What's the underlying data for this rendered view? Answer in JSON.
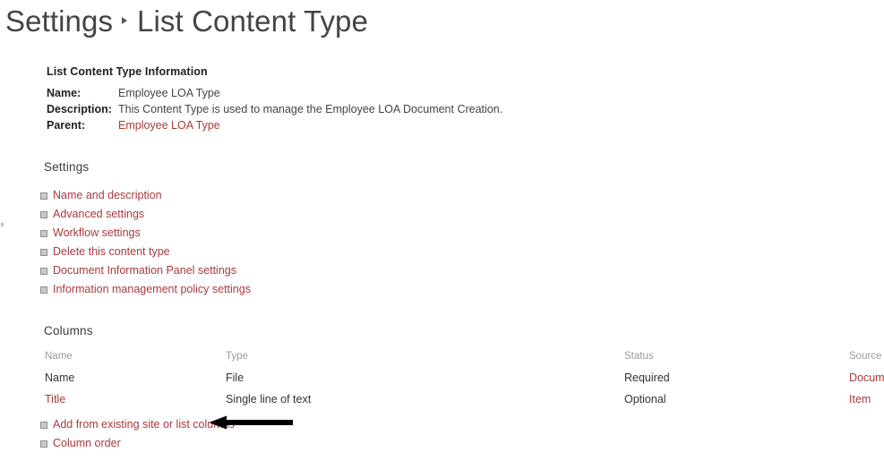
{
  "page": {
    "breadcrumb": {
      "root": "Settings",
      "separator_icon": "chevron-right-icon",
      "current": "List Content Type"
    }
  },
  "info": {
    "heading": "List Content Type Information",
    "rows": [
      {
        "label": "Name:",
        "value": "Employee LOA Type",
        "is_link": false
      },
      {
        "label": "Description:",
        "value": "This Content Type is used to manage the Employee LOA Document Creation.",
        "is_link": false
      },
      {
        "label": "Parent:",
        "value": "Employee LOA Type",
        "is_link": true
      }
    ]
  },
  "settings": {
    "heading": "Settings",
    "bullet_icon": "small-square-bullet-icon",
    "links": [
      {
        "label": "Name and description"
      },
      {
        "label": "Advanced settings"
      },
      {
        "label": "Workflow settings"
      },
      {
        "label": "Delete this content type"
      },
      {
        "label": "Document Information Panel settings"
      },
      {
        "label": "Information management policy settings"
      }
    ]
  },
  "columns": {
    "heading": "Columns",
    "table": {
      "headers": [
        "Name",
        "Type",
        "Status",
        "Source"
      ],
      "rows": [
        {
          "name": "Name",
          "name_is_link": false,
          "type": "File",
          "status": "Required",
          "source": "Docume",
          "source_is_link": true
        },
        {
          "name": "Title",
          "name_is_link": true,
          "type": "Single line of text",
          "status": "Optional",
          "source": "Item",
          "source_is_link": true
        }
      ]
    },
    "bullet_icon": "small-square-bullet-icon",
    "links": [
      {
        "label": "Add from existing site or list columns"
      },
      {
        "label": "Column order"
      }
    ]
  },
  "annotation": {
    "arrow_icon": "left-pointing-arrow-annotation",
    "color": "#000000"
  },
  "colors": {
    "link": "#a83a3d",
    "text": "#333333",
    "muted": "#9b9b9b",
    "heading": "#3b3b3b",
    "title": "#444444",
    "background": "#ffffff"
  }
}
